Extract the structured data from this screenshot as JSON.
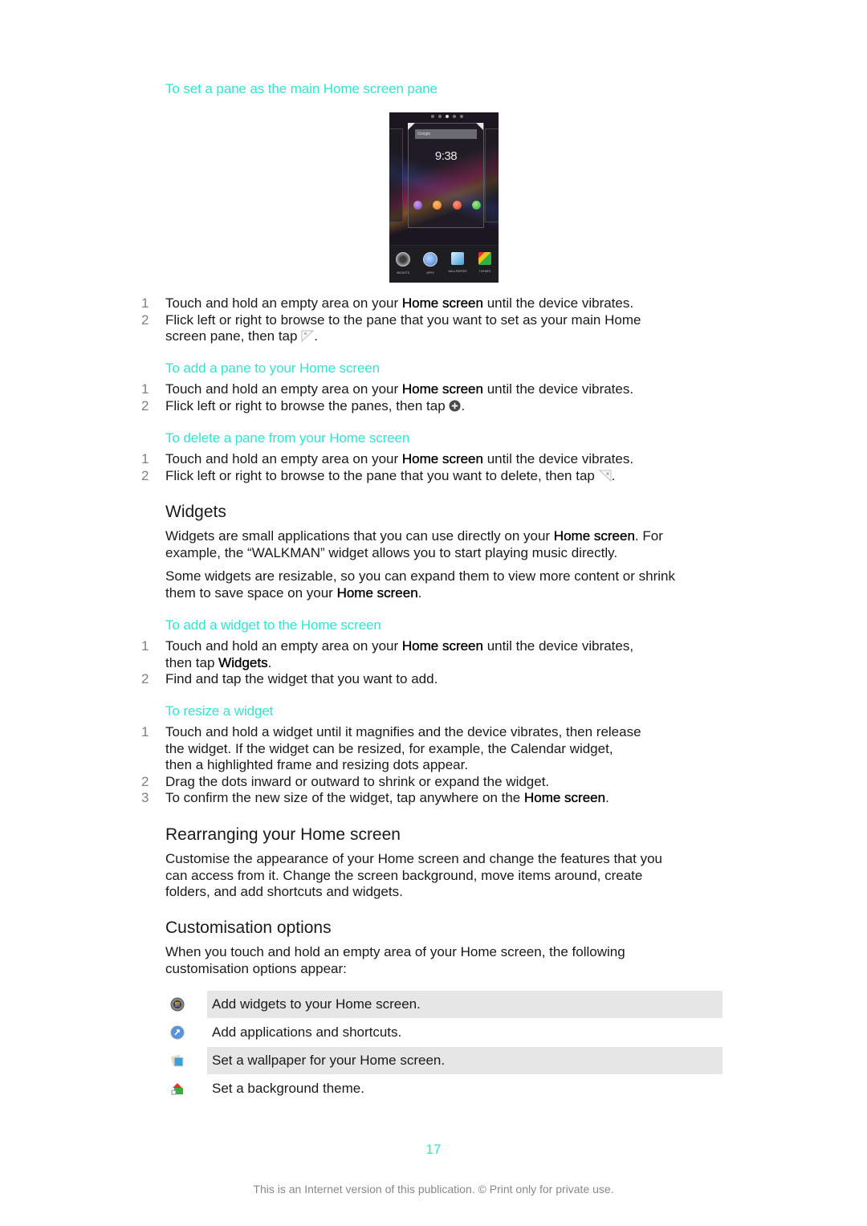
{
  "sections": {
    "set_main_pane": {
      "title": "To set a pane as the main Home screen pane",
      "steps": [
        {
          "num": "1",
          "pre": "Touch and hold an empty area on your ",
          "bold": "Home screen",
          "post": " until the device vibrates."
        },
        {
          "num": "2",
          "line1": "Flick left or right to browse to the pane that you want to set as your main Home",
          "line2_pre": "screen pane, then tap ",
          "icon": "home-pane-corner-icon",
          "line2_post": "."
        }
      ]
    },
    "add_pane": {
      "title": "To add a pane to your Home screen",
      "steps": [
        {
          "num": "1",
          "pre": "Touch and hold an empty area on your ",
          "bold": "Home screen",
          "post": " until the device vibrates."
        },
        {
          "num": "2",
          "pre": "Flick left or right to browse the panes, then tap ",
          "icon": "add-circle-icon",
          "post": "."
        }
      ]
    },
    "delete_pane": {
      "title": "To delete a pane from your Home screen",
      "steps": [
        {
          "num": "1",
          "pre": "Touch and hold an empty area on your ",
          "bold": "Home screen",
          "post": " until the device vibrates."
        },
        {
          "num": "2",
          "pre": "Flick left or right to browse to the pane that you want to delete, then tap ",
          "icon": "delete-pane-corner-icon",
          "post": "."
        }
      ]
    },
    "widgets": {
      "heading": "Widgets",
      "para1_pre": "Widgets are small applications that you can use directly on your ",
      "para1_bold": "Home screen",
      "para1_mid": ". For",
      "para1_line2": "example, the “WALKMAN” widget allows you to start playing music directly.",
      "para2_line1": "Some widgets are resizable, so you can expand them to view more content or shrink",
      "para2_pre": "them to save space on your ",
      "para2_bold": "Home screen",
      "para2_post": "."
    },
    "add_widget": {
      "title": "To add a widget to the Home screen",
      "steps": [
        {
          "num": "1",
          "pre": "Touch and hold an empty area on your ",
          "bold": "Home screen",
          "post": " until the device vibrates,",
          "line2_pre": "then tap ",
          "line2_bold": "Widgets",
          "line2_post": "."
        },
        {
          "num": "2",
          "text": "Find and tap the widget that you want to add."
        }
      ]
    },
    "resize_widget": {
      "title": "To resize a widget",
      "steps": [
        {
          "num": "1",
          "line1": "Touch and hold a widget until it magnifies and the device vibrates, then release",
          "line2": "the widget. If the widget can be resized, for example, the Calendar widget,",
          "line3": "then a highlighted frame and resizing dots appear."
        },
        {
          "num": "2",
          "text": "Drag the dots inward or outward to shrink or expand the widget."
        },
        {
          "num": "3",
          "pre": "To confirm the new size of the widget, tap anywhere on the ",
          "bold": "Home screen",
          "post": "."
        }
      ]
    },
    "rearranging": {
      "heading": "Rearranging your Home screen",
      "lines": [
        "Customise the appearance of your Home screen and change the features that you",
        "can access from it. Change the screen background, move items around, create",
        "folders, and add shortcuts and widgets."
      ]
    },
    "customisation": {
      "heading": "Customisation options",
      "lines": [
        "When you touch and hold an empty area of your Home screen, the following",
        "customisation options appear:"
      ],
      "options": [
        {
          "icon": "widgets-icon",
          "text": "Add widgets to your Home screen."
        },
        {
          "icon": "apps-icon",
          "text": "Add applications and shortcuts."
        },
        {
          "icon": "wallpapers-icon",
          "text": "Set a wallpaper for your Home screen."
        },
        {
          "icon": "themes-icon",
          "text": "Set a background theme."
        }
      ]
    }
  },
  "phone_screenshot": {
    "search_label": "Google",
    "clock": "9:38",
    "dock": [
      "WIDGETS",
      "APPS",
      "WALLPAPERS",
      "THEMES"
    ]
  },
  "colors": {
    "accent": "#2ee6d0",
    "text": "#1a1a1a",
    "step_number": "#808080",
    "shaded_row": "#e6e6e6"
  },
  "page_number": "17",
  "footer": "This is an Internet version of this publication. © Print only for private use."
}
